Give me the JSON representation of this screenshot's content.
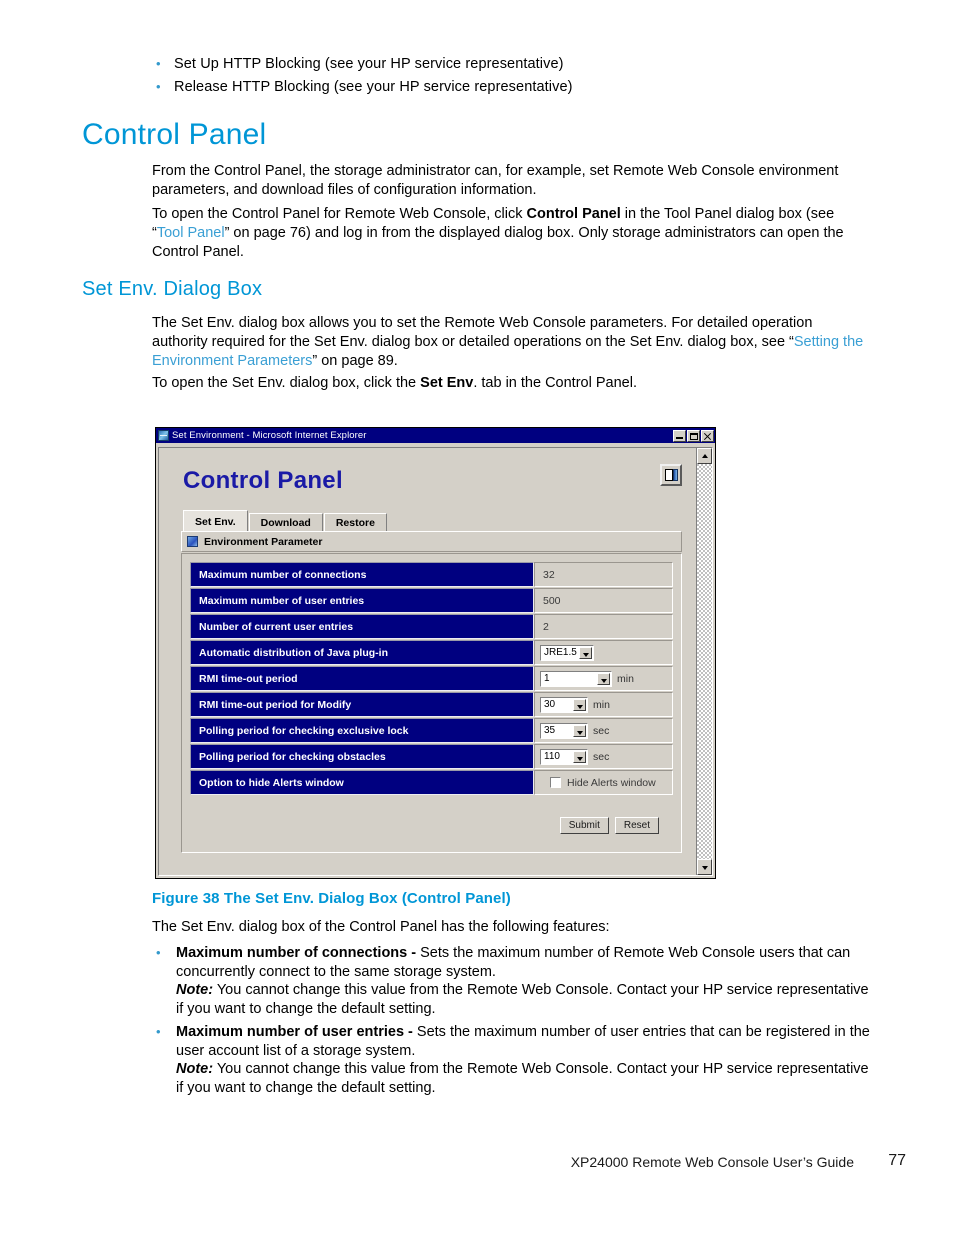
{
  "top_bullets": [
    "Set Up HTTP Blocking (see your HP service representative)",
    "Release HTTP Blocking (see your HP service representative)"
  ],
  "headings": {
    "section": "Control Panel",
    "subsection": "Set Env.  Dialog Box"
  },
  "paragraphs": {
    "p1": "From the Control Panel, the storage administrator can, for example, set Remote Web Console environment parameters, and download files of configuration information.",
    "p2_a": "To open the Control Panel for Remote Web Console, click ",
    "p2_b": "Control Panel",
    "p2_c": " in the Tool Panel dialog box (see “",
    "p2_link": "Tool Panel",
    "p2_d": "” on page 76) and log in from the displayed dialog box.  Only storage administrators can open the Control Panel.",
    "p3_a": "The Set Env. dialog box allows you to set the Remote Web Console parameters.  For detailed operation authority required for the Set Env.  dialog box or detailed operations on the Set Env.  dialog box, see “",
    "p3_link": "Setting the Environment Parameters",
    "p3_b": "” on page 89.",
    "p4_a": "To open the Set Env. dialog box, click the ",
    "p4_b": "Set Env",
    "p4_c": ". tab in the Control Panel.",
    "p5": "The Set Env. dialog box of the Control Panel has the following features:"
  },
  "figure": {
    "caption": "Figure 38 The Set Env.  Dialog Box (Control Panel)"
  },
  "features": [
    {
      "term": "Maximum number of connections -",
      "desc": " Sets the maximum number of Remote Web Console users that can concurrently connect to the same storage system.",
      "note_label": "Note:",
      "note": " You cannot change this value from the Remote Web Console.  Contact your HP service representative if you want to change the default setting."
    },
    {
      "term": "Maximum number of user entries -",
      "desc": " Sets the maximum number of user entries that can be registered in the user account list of a storage system.",
      "note_label": "Note:",
      "note": " You cannot change this value from the Remote Web Console.  Contact your HP service representative if you want to change the default setting."
    }
  ],
  "footer": {
    "guide": "XP24000 Remote Web Console User’s Guide",
    "page": "77"
  },
  "dialog": {
    "window_title": "Set Environment - Microsoft Internet Explorer",
    "title_buttons": {
      "minimize": "minimize-icon",
      "maximize": "maximize-icon",
      "close": "close-icon"
    },
    "app_title": "Control Panel",
    "exit_icon": "exit-door-icon",
    "tabs": [
      {
        "label": "Set Env.",
        "active": true
      },
      {
        "label": "Download",
        "active": false
      },
      {
        "label": "Restore",
        "active": false
      }
    ],
    "section_header": {
      "icon": "parameter-icon",
      "label": "Environment Parameter"
    },
    "parameters": [
      {
        "label": "Maximum number of connections",
        "kind": "text",
        "value": "32",
        "unit": ""
      },
      {
        "label": "Maximum number of user entries",
        "kind": "text",
        "value": "500",
        "unit": ""
      },
      {
        "label": "Number of current user entries",
        "kind": "text",
        "value": "2",
        "unit": ""
      },
      {
        "label": "Automatic distribution of Java plug-in",
        "kind": "combo",
        "value": "JRE1.5",
        "unit": ""
      },
      {
        "label": "RMI time-out period",
        "kind": "combo",
        "value": "1",
        "unit": "min"
      },
      {
        "label": "RMI time-out period for Modify",
        "kind": "combo",
        "value": "30",
        "unit": "min"
      },
      {
        "label": "Polling period for checking exclusive lock",
        "kind": "combo",
        "value": "35",
        "unit": "sec"
      },
      {
        "label": "Polling period for checking obstacles",
        "kind": "combo",
        "value": "110",
        "unit": "sec"
      },
      {
        "label": "Option to hide Alerts window",
        "kind": "checkbox",
        "value": "Hide Alerts window",
        "checked": false,
        "unit": ""
      }
    ],
    "buttons": {
      "submit": "Submit",
      "reset": "Reset"
    }
  }
}
